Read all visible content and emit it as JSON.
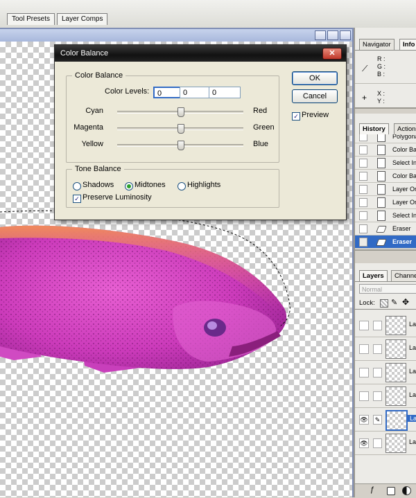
{
  "palette_well": {
    "tabs": [
      "Tool Presets",
      "Layer Comps"
    ]
  },
  "dialog": {
    "title": "Color Balance",
    "close_glyph": "✕",
    "color_balance_legend": "Color Balance",
    "color_levels_label": "Color Levels:",
    "levels": [
      "0",
      "0",
      "0"
    ],
    "sliders": [
      {
        "left": "Cyan",
        "right": "Red",
        "value": 0
      },
      {
        "left": "Magenta",
        "right": "Green",
        "value": 0
      },
      {
        "left": "Yellow",
        "right": "Blue",
        "value": 0
      }
    ],
    "tone_balance_legend": "Tone Balance",
    "tones": [
      "Shadows",
      "Midtones",
      "Highlights"
    ],
    "selected_tone": "Midtones",
    "preserve_luminosity_label": "Preserve Luminosity",
    "preserve_luminosity_checked": true,
    "ok_label": "OK",
    "cancel_label": "Cancel",
    "preview_label": "Preview",
    "preview_checked": true
  },
  "navigator": {
    "tabs": [
      "Navigator",
      "Info"
    ],
    "rgb_labels": [
      "R :",
      "G :",
      "B :"
    ],
    "xy_labels": [
      "X :",
      "Y :"
    ]
  },
  "history": {
    "tabs": [
      "History",
      "Actions"
    ],
    "items": [
      "Polygonal",
      "Color Ba",
      "Select In",
      "Color Ba",
      "Layer Or",
      "Layer Or",
      "Select In",
      "Eraser",
      "Eraser"
    ],
    "selected_index": 8
  },
  "layers": {
    "tabs": [
      "Layers",
      "Channe"
    ],
    "blend_mode": "Normal",
    "lock_label": "Lock:",
    "rows": [
      {
        "name": "Lay",
        "visible": false,
        "linked": false
      },
      {
        "name": "Lay",
        "visible": false,
        "linked": false
      },
      {
        "name": "Lay",
        "visible": false,
        "linked": false
      },
      {
        "name": "Lay",
        "visible": false,
        "linked": false
      },
      {
        "name": "Lay",
        "visible": true,
        "linked": true,
        "selected": true
      },
      {
        "name": "Lay",
        "visible": true,
        "linked": false
      }
    ]
  },
  "colors": {
    "selection_blue": "#316ac5",
    "fish_magenta": "#d63fc0"
  }
}
